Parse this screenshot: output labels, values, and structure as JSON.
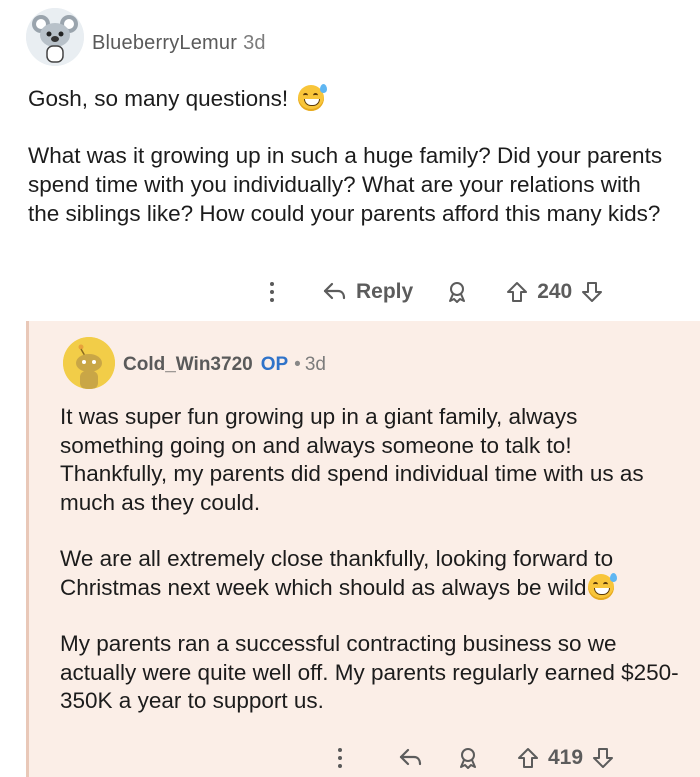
{
  "comment": {
    "username": "BlueberryLemur",
    "age": "3d",
    "paragraph1": "Gosh, so many questions!",
    "paragraph2": "What was it growing up in such a huge family? Did your parents spend time with you individually? What are your relations with the siblings like? How could your parents afford this many kids?",
    "reply_label": "Reply",
    "score": "240"
  },
  "reply": {
    "username": "Cold_Win3720",
    "op_badge": "OP",
    "separator": "•",
    "age": "3d",
    "paragraph1": "It was super fun growing up in a giant family, always something going on and always someone to talk to! Thankfully, my parents did spend individual time with us as much as they could.",
    "paragraph2": "We are all extremely close thankfully, looking forward to Christmas next week which should as always be wild",
    "paragraph3": "My parents ran a successful contracting business so we actually were quite well off. My parents regularly earned $250-350K a year to support us.",
    "score": "419"
  },
  "icons": [
    "more-options-icon",
    "reply-arrow-icon",
    "award-icon",
    "upvote-icon",
    "downvote-icon",
    "sweat-smile-emoji"
  ],
  "colors": {
    "op_badge": "#2f73c9",
    "reply_background": "#fbeee7",
    "reply_thread_line": "#e9c8b8"
  }
}
